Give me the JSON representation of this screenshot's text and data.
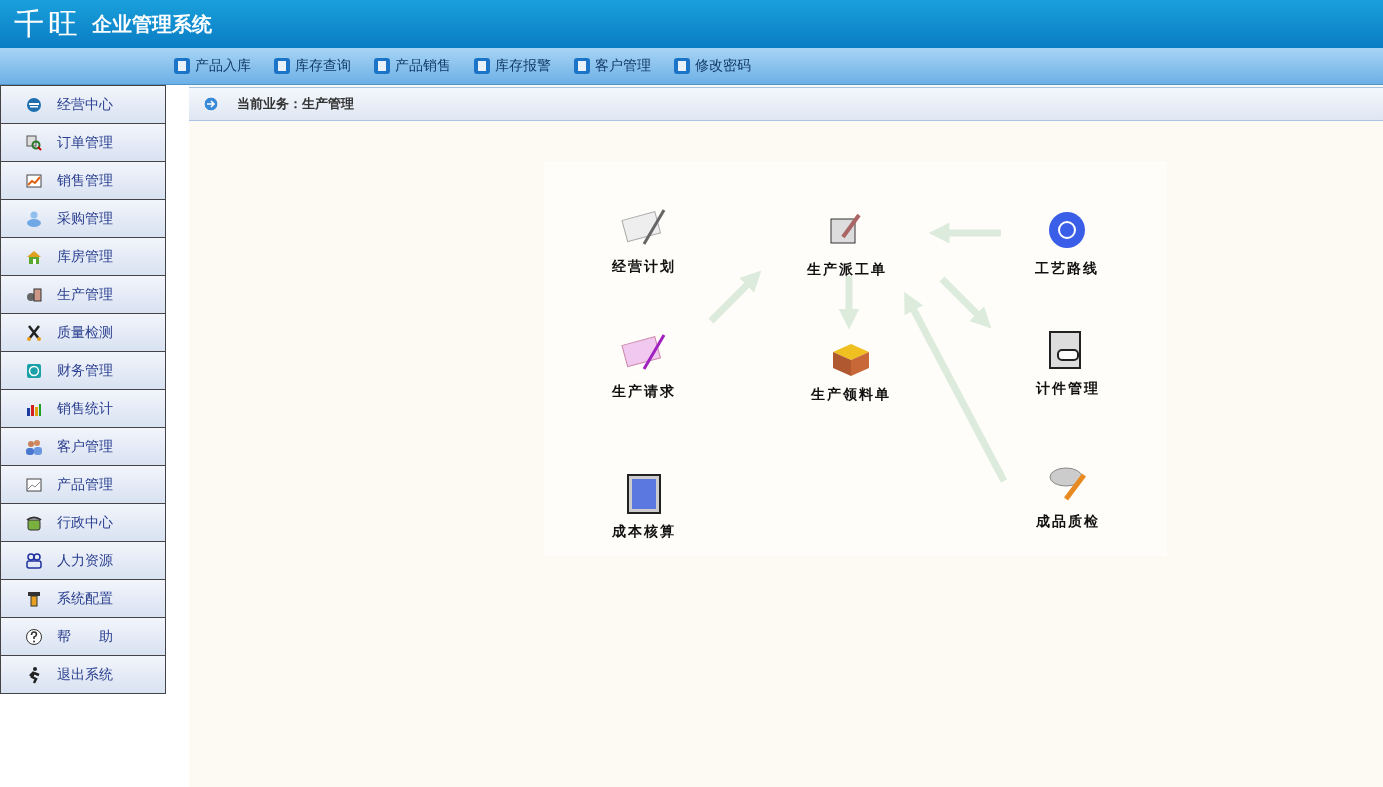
{
  "header": {
    "logo": "千旺",
    "title": "企业管理系统"
  },
  "toolbar": [
    {
      "label": "产品入库"
    },
    {
      "label": "库存查询"
    },
    {
      "label": "产品销售"
    },
    {
      "label": "库存报警"
    },
    {
      "label": "客户管理"
    },
    {
      "label": "修改密码"
    }
  ],
  "sidebar": {
    "items": [
      {
        "label": "经营中心"
      },
      {
        "label": "订单管理"
      },
      {
        "label": "销售管理"
      },
      {
        "label": "采购管理"
      },
      {
        "label": "库房管理"
      },
      {
        "label": "生产管理"
      },
      {
        "label": "质量检测"
      },
      {
        "label": "财务管理"
      },
      {
        "label": "销售统计"
      },
      {
        "label": "客户管理"
      },
      {
        "label": "产品管理"
      },
      {
        "label": "行政中心"
      },
      {
        "label": "人力资源"
      },
      {
        "label": "系统配置"
      },
      {
        "label": "帮　　助"
      },
      {
        "label": "退出系统"
      }
    ]
  },
  "breadcrumb": "当前业务：生产管理",
  "diagram": {
    "nodes": [
      {
        "label": "经营计划"
      },
      {
        "label": "生产派工单"
      },
      {
        "label": "工艺路线"
      },
      {
        "label": "生产请求"
      },
      {
        "label": "生产领料单"
      },
      {
        "label": "计件管理"
      },
      {
        "label": "成本核算"
      },
      {
        "label": "成品质检"
      }
    ]
  }
}
